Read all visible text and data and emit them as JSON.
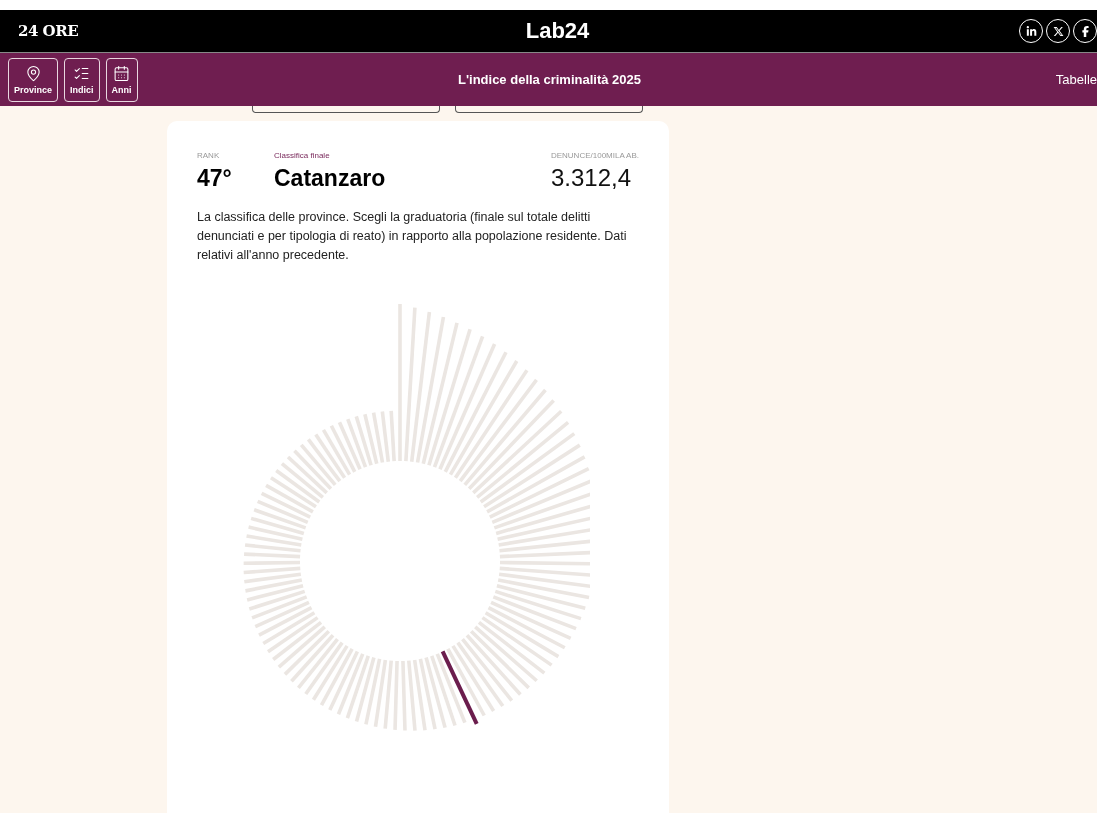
{
  "topbar": {
    "logo": "24 ORE",
    "brand": "Lab24"
  },
  "navbar": {
    "buttons": [
      {
        "label": "Province",
        "kind": "pin"
      },
      {
        "label": "Indici",
        "kind": "list"
      },
      {
        "label": "Anni",
        "kind": "calendar"
      }
    ],
    "title": "L'indice della criminalità 2025",
    "link": "Tabelle"
  },
  "card": {
    "rank_label": "RANK",
    "ranking_label": "Classifica finale",
    "value_label": "DENUNCE/100MILA AB.",
    "rank": "47°",
    "province": "Catanzaro",
    "value": "3.312,4",
    "description": "La classifica delle province. Scegli la graduatoria (finale sul totale delitti denunciati e per tipologia di reato) in rapporto alla popolazione residente. Dati relativi all'anno precedente."
  }
}
